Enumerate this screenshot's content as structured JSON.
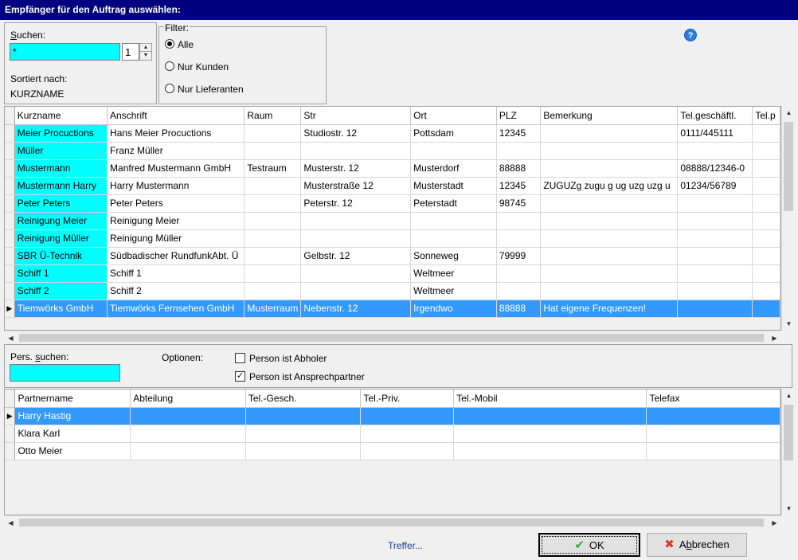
{
  "window": {
    "title": "Empfänger für den Auftrag auswählen:"
  },
  "search": {
    "label_pre": "",
    "label_u": "S",
    "label_post": "uchen:",
    "value": "*",
    "spin_value": "1",
    "sorted_label": "Sortiert nach:",
    "sorted_value": "KURZNAME"
  },
  "filter": {
    "title": "Filter:",
    "options": [
      {
        "label": "Alle",
        "selected": true
      },
      {
        "label": "Nur Kunden",
        "selected": false
      },
      {
        "label": "Nur Lieferanten",
        "selected": false
      }
    ]
  },
  "help": {
    "icon": "help-icon",
    "glyph": "?"
  },
  "recipients": {
    "columns": [
      "Kurzname",
      "Anschrift",
      "Raum",
      "Str",
      "Ort",
      "PLZ",
      "Bemerkung",
      "Tel.geschäftl.",
      "Tel.p"
    ],
    "rows": [
      [
        "Meier Procuctions",
        "Hans Meier Procuctions",
        "",
        "Studiostr. 12",
        "Pottsdam",
        "12345",
        "",
        "0111/445111",
        ""
      ],
      [
        "Müller",
        "Franz Müller",
        "",
        "",
        "",
        "",
        "",
        "",
        ""
      ],
      [
        "Mustermann",
        "Manfred Mustermann GmbH",
        "Testraum",
        "Musterstr. 12",
        "Musterdorf",
        "88888",
        "",
        "08888/12346-0",
        ""
      ],
      [
        "Mustermann Harry",
        "Harry Mustermann",
        "",
        "Musterstraße 12",
        "Musterstadt",
        "12345",
        "ZUGUZg zugu g ug uzg uzg u",
        "01234/56789",
        ""
      ],
      [
        "Peter Peters",
        "Peter Peters",
        "",
        "Peterstr. 12",
        "Peterstadt",
        "98745",
        "",
        "",
        ""
      ],
      [
        "Reinigung Meier",
        "Reinigung Meier",
        "",
        "",
        "",
        "",
        "",
        "",
        ""
      ],
      [
        "Reinigung Müller",
        "Reinigung Müller",
        "",
        "",
        "",
        "",
        "",
        "",
        ""
      ],
      [
        "SBR Ü-Technik",
        "Südbadischer RundfunkAbt. Ü",
        "",
        "Gelbstr. 12",
        "Sonneweg",
        "79999",
        "",
        "",
        ""
      ],
      [
        "Schiff 1",
        "Schiff 1",
        "",
        "",
        "Weltmeer",
        "",
        "",
        "",
        ""
      ],
      [
        "Schiff 2",
        "Schiff 2",
        "",
        "",
        "Weltmeer",
        "",
        "",
        "",
        ""
      ],
      [
        "Tiemwörks GmbH",
        "Tiemwörks Fernsehen GmbH",
        "Musterraum",
        "Nebenstr. 12",
        "Irgendwo",
        "88888",
        "Hat eigene Frequenzen!",
        "",
        ""
      ]
    ],
    "selected_index": 10
  },
  "person": {
    "search_label_pre": "Pers. ",
    "search_label_u": "s",
    "search_label_post": "uchen:",
    "search_value": "",
    "options_label": "Optionen:",
    "check_abholer": {
      "label": "Person ist Abholer",
      "checked": false
    },
    "check_ansprech": {
      "label": "Person ist Ansprechpartner",
      "checked": true
    }
  },
  "partners": {
    "columns": [
      "Partnername",
      "Abteilung",
      "Tel.-Gesch.",
      "Tel.-Priv.",
      "Tel.-Mobil",
      "Telefax"
    ],
    "rows": [
      [
        "Harry Hastig",
        "",
        "",
        "",
        "",
        ""
      ],
      [
        "Klara Karl",
        "",
        "",
        "",
        "",
        ""
      ],
      [
        "Otto Meier",
        "",
        "",
        "",
        "",
        ""
      ]
    ],
    "selected_index": 0
  },
  "footer": {
    "treffer": "Treffer...",
    "ok_label": "OK",
    "ok_icon": "check-icon",
    "cancel_pre": "A",
    "cancel_u": "b",
    "cancel_post": "brechen",
    "cancel_icon": "x-icon"
  },
  "colors": {
    "title_bg": "#000080",
    "key_cell": "#00ffff",
    "selection": "#3399ff",
    "link": "#1a3f8c"
  }
}
